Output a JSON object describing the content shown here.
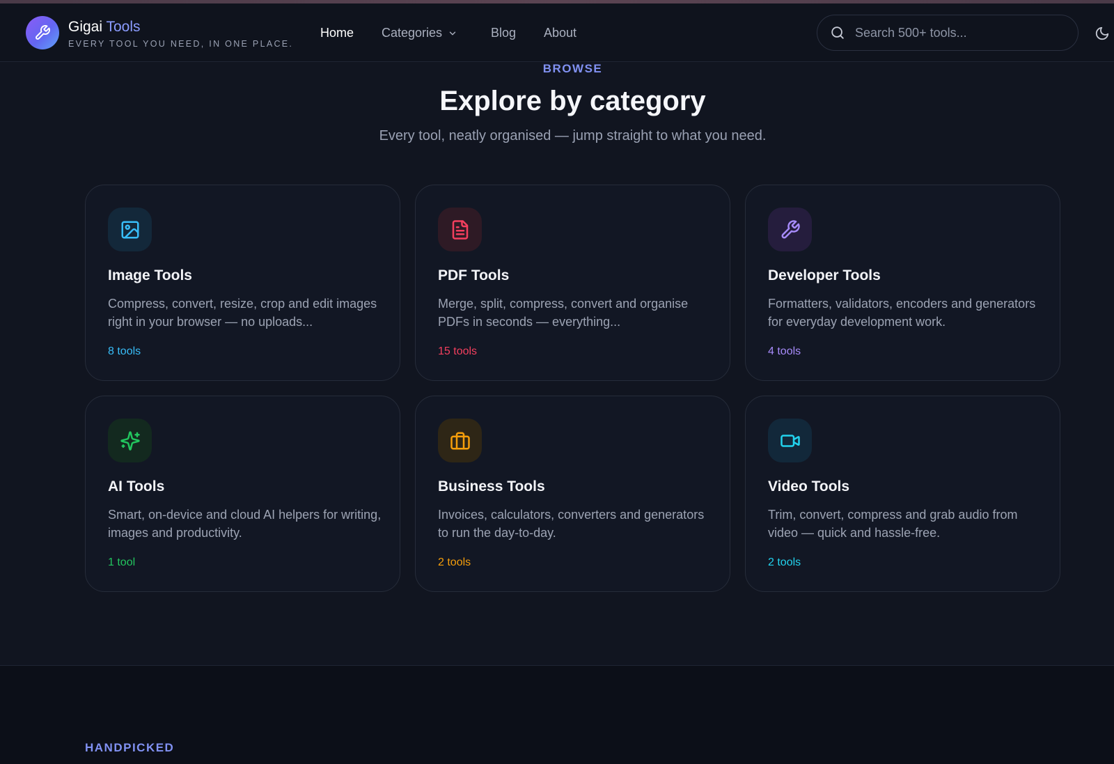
{
  "brand": {
    "name_first": "Gigai",
    "name_second": "Tools",
    "tagline": "EVERY TOOL YOU NEED, IN ONE PLACE."
  },
  "nav": {
    "home": "Home",
    "categories": "Categories",
    "blog": "Blog",
    "about": "About"
  },
  "search": {
    "placeholder": "Search 500+ tools..."
  },
  "section": {
    "eyebrow": "BROWSE",
    "title": "Explore by category",
    "subtitle": "Every tool, neatly organised — jump straight to what you need."
  },
  "categories": [
    {
      "title": "Image Tools",
      "description": "Compress, convert, resize, crop and edit images right in your browser — no uploads...",
      "count": "8 tools",
      "icon": "image-icon",
      "color": "#38bdf8",
      "bg": "#13283a"
    },
    {
      "title": "PDF Tools",
      "description": "Merge, split, compress, convert and organise PDFs in seconds — everything...",
      "count": "15 tools",
      "icon": "document-icon",
      "color": "#f43f5e",
      "bg": "#2e1a25"
    },
    {
      "title": "Developer Tools",
      "description": "Formatters, validators, encoders and generators for everyday development work.",
      "count": "4 tools",
      "icon": "wrench-icon",
      "color": "#a78bfa",
      "bg": "#251d3d"
    },
    {
      "title": "AI Tools",
      "description": "Smart, on-device and cloud AI helpers for writing, images and productivity.",
      "count": "1 tool",
      "icon": "sparkles-icon",
      "color": "#22c55e",
      "bg": "#13291f"
    },
    {
      "title": "Business Tools",
      "description": "Invoices, calculators, converters and generators to run the day-to-day.",
      "count": "2 tools",
      "icon": "briefcase-icon",
      "color": "#f59e0b",
      "bg": "#2e2616"
    },
    {
      "title": "Video Tools",
      "description": "Trim, convert, compress and grab audio from video — quick and hassle-free.",
      "count": "2 tools",
      "icon": "video-icon",
      "color": "#22d3ee",
      "bg": "#12283a"
    }
  ],
  "next_section": {
    "eyebrow": "HANDPICKED"
  }
}
